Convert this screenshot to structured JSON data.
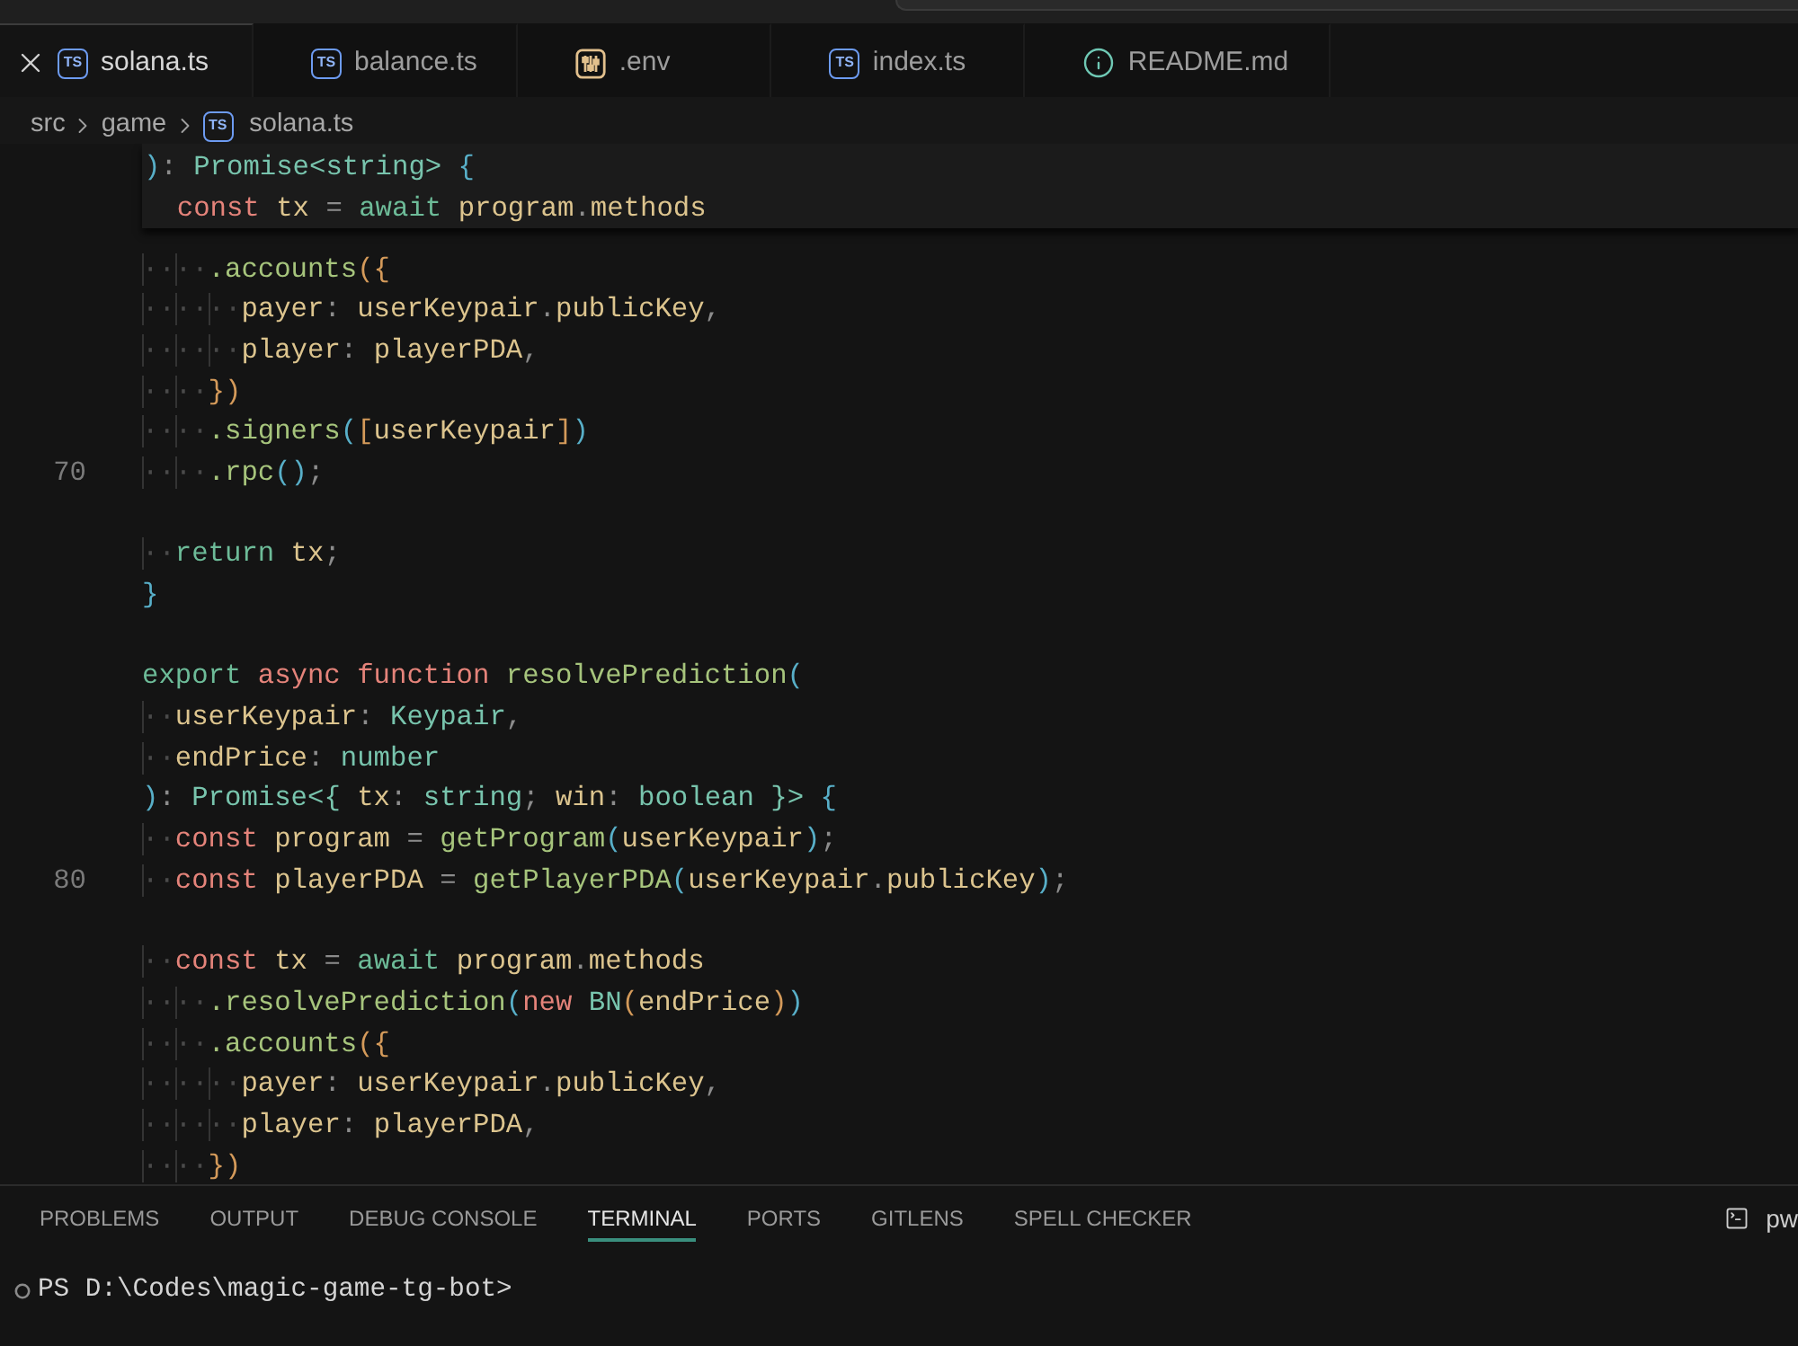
{
  "tabs": [
    {
      "label": "solana.ts",
      "kind": "ts",
      "badge": "TS",
      "selected": true
    },
    {
      "label": "balance.ts",
      "kind": "ts",
      "badge": "TS",
      "selected": false
    },
    {
      "label": ".env",
      "kind": "env",
      "selected": false
    },
    {
      "label": "index.ts",
      "kind": "ts",
      "badge": "TS",
      "selected": false
    },
    {
      "label": "README.md",
      "kind": "info",
      "selected": false
    }
  ],
  "breadcrumb": [
    {
      "label": "src",
      "kind": "folder"
    },
    {
      "label": "game",
      "kind": "folder"
    },
    {
      "label": "solana.ts",
      "kind": "ts",
      "badge": "TS"
    }
  ],
  "editor": {
    "sticky_scroll": [
      {
        "tokens": [
          {
            "text": ")",
            "kind": "bracket1"
          },
          {
            "text": ": ",
            "kind": "punct"
          },
          {
            "text": "Promise<string>",
            "kind": "type"
          },
          {
            "text": " {",
            "kind": "bracket1"
          }
        ],
        "children": [
          {
            "tokens": [
              {
                "text": "const ",
                "kind": "keyword"
              },
              {
                "text": "tx",
                "kind": "variable"
              },
              {
                "text": " = ",
                "kind": "punct"
              },
              {
                "text": "await ",
                "kind": "control"
              },
              {
                "text": "program",
                "kind": "variable"
              },
              {
                "text": ".",
                "kind": "punct"
              },
              {
                "text": "methods",
                "kind": "variable"
              }
            ]
          }
        ]
      }
    ],
    "lines": [
      {
        "kind": "code",
        "tokens": [
          {
            "text": "····",
            "kind": "whitespace"
          },
          {
            "text": ".accounts",
            "kind": "function"
          },
          {
            "text": "({",
            "kind": "bracket2"
          }
        ]
      },
      {
        "kind": "code",
        "tokens": [
          {
            "text": "······",
            "kind": "whitespace"
          },
          {
            "text": "payer",
            "kind": "variable"
          },
          {
            "text": ": ",
            "kind": "punct"
          },
          {
            "text": "userKeypair",
            "kind": "variable"
          },
          {
            "text": ".",
            "kind": "punct"
          },
          {
            "text": "publicKey",
            "kind": "variable"
          },
          {
            "text": ",",
            "kind": "punct"
          }
        ]
      },
      {
        "kind": "code",
        "tokens": [
          {
            "text": "······",
            "kind": "whitespace"
          },
          {
            "text": "player",
            "kind": "variable"
          },
          {
            "text": ": ",
            "kind": "punct"
          },
          {
            "text": "playerPDA",
            "kind": "variable"
          },
          {
            "text": ",",
            "kind": "punct"
          }
        ]
      },
      {
        "kind": "code",
        "tokens": [
          {
            "text": "····",
            "kind": "whitespace"
          },
          {
            "text": "})",
            "kind": "bracket2"
          }
        ]
      },
      {
        "kind": "code",
        "tokens": [
          {
            "text": "····",
            "kind": "whitespace"
          },
          {
            "text": ".signers",
            "kind": "function"
          },
          {
            "text": "(",
            "kind": "bracket1"
          },
          {
            "text": "[",
            "kind": "bracket2"
          },
          {
            "text": "userKeypair",
            "kind": "variable"
          },
          {
            "text": "]",
            "kind": "bracket2"
          },
          {
            "text": ")",
            "kind": "bracket1"
          }
        ]
      },
      {
        "kind": "code",
        "number": "70",
        "tokens": [
          {
            "text": "····",
            "kind": "whitespace"
          },
          {
            "text": ".rpc",
            "kind": "function"
          },
          {
            "text": "()",
            "kind": "bracket1"
          },
          {
            "text": ";",
            "kind": "punct"
          }
        ]
      },
      {
        "kind": "blank"
      },
      {
        "kind": "code",
        "tokens": [
          {
            "text": "··",
            "kind": "whitespace"
          },
          {
            "text": "return ",
            "kind": "control"
          },
          {
            "text": "tx",
            "kind": "variable"
          },
          {
            "text": ";",
            "kind": "punct"
          }
        ]
      },
      {
        "kind": "code",
        "tokens": [
          {
            "text": "}",
            "kind": "bracket1"
          }
        ]
      },
      {
        "kind": "blank"
      },
      {
        "kind": "code",
        "tokens": [
          {
            "text": "export ",
            "kind": "control"
          },
          {
            "text": "async ",
            "kind": "keyword"
          },
          {
            "text": "function ",
            "kind": "keyword"
          },
          {
            "text": "resolvePrediction",
            "kind": "function"
          },
          {
            "text": "(",
            "kind": "bracket1"
          }
        ]
      },
      {
        "kind": "code",
        "tokens": [
          {
            "text": "··",
            "kind": "whitespace"
          },
          {
            "text": "userKeypair",
            "kind": "variable"
          },
          {
            "text": ": ",
            "kind": "punct"
          },
          {
            "text": "Keypair",
            "kind": "type"
          },
          {
            "text": ",",
            "kind": "punct"
          }
        ]
      },
      {
        "kind": "code",
        "tokens": [
          {
            "text": "··",
            "kind": "whitespace"
          },
          {
            "text": "endPrice",
            "kind": "variable"
          },
          {
            "text": ": ",
            "kind": "punct"
          },
          {
            "text": "number",
            "kind": "type"
          }
        ]
      },
      {
        "kind": "code",
        "tokens": [
          {
            "text": ")",
            "kind": "bracket1"
          },
          {
            "text": ": ",
            "kind": "punct"
          },
          {
            "text": "Promise<{ ",
            "kind": "type"
          },
          {
            "text": "tx",
            "kind": "variable"
          },
          {
            "text": ": ",
            "kind": "punct"
          },
          {
            "text": "string",
            "kind": "type"
          },
          {
            "text": "; ",
            "kind": "punct"
          },
          {
            "text": "win",
            "kind": "variable"
          },
          {
            "text": ": ",
            "kind": "punct"
          },
          {
            "text": "boolean",
            "kind": "type"
          },
          {
            "text": " }>",
            "kind": "type"
          },
          {
            "text": " {",
            "kind": "bracket1"
          }
        ]
      },
      {
        "kind": "code",
        "tokens": [
          {
            "text": "··",
            "kind": "whitespace"
          },
          {
            "text": "const ",
            "kind": "keyword"
          },
          {
            "text": "program",
            "kind": "variable"
          },
          {
            "text": " = ",
            "kind": "punct"
          },
          {
            "text": "getProgram",
            "kind": "function"
          },
          {
            "text": "(",
            "kind": "bracket1"
          },
          {
            "text": "userKeypair",
            "kind": "variable"
          },
          {
            "text": ")",
            "kind": "bracket1"
          },
          {
            "text": ";",
            "kind": "punct"
          }
        ]
      },
      {
        "kind": "code",
        "number": "80",
        "tokens": [
          {
            "text": "··",
            "kind": "whitespace"
          },
          {
            "text": "const ",
            "kind": "keyword"
          },
          {
            "text": "playerPDA",
            "kind": "variable"
          },
          {
            "text": " = ",
            "kind": "punct"
          },
          {
            "text": "getPlayerPDA",
            "kind": "function"
          },
          {
            "text": "(",
            "kind": "bracket1"
          },
          {
            "text": "userKeypair",
            "kind": "variable"
          },
          {
            "text": ".",
            "kind": "punct"
          },
          {
            "text": "publicKey",
            "kind": "variable"
          },
          {
            "text": ")",
            "kind": "bracket1"
          },
          {
            "text": ";",
            "kind": "punct"
          }
        ]
      },
      {
        "kind": "blank"
      },
      {
        "kind": "code",
        "tokens": [
          {
            "text": "··",
            "kind": "whitespace"
          },
          {
            "text": "const ",
            "kind": "keyword"
          },
          {
            "text": "tx",
            "kind": "variable"
          },
          {
            "text": " = ",
            "kind": "punct"
          },
          {
            "text": "await ",
            "kind": "control"
          },
          {
            "text": "program",
            "kind": "variable"
          },
          {
            "text": ".",
            "kind": "punct"
          },
          {
            "text": "methods",
            "kind": "variable"
          }
        ]
      },
      {
        "kind": "code",
        "tokens": [
          {
            "text": "····",
            "kind": "whitespace"
          },
          {
            "text": ".resolvePrediction",
            "kind": "function"
          },
          {
            "text": "(",
            "kind": "bracket1"
          },
          {
            "text": "new ",
            "kind": "keyword"
          },
          {
            "text": "BN",
            "kind": "type"
          },
          {
            "text": "(",
            "kind": "bracket2"
          },
          {
            "text": "endPrice",
            "kind": "variable"
          },
          {
            "text": ")",
            "kind": "bracket2"
          },
          {
            "text": ")",
            "kind": "bracket1"
          }
        ]
      },
      {
        "kind": "code",
        "tokens": [
          {
            "text": "····",
            "kind": "whitespace"
          },
          {
            "text": ".accounts",
            "kind": "function"
          },
          {
            "text": "({",
            "kind": "bracket2"
          }
        ]
      },
      {
        "kind": "code",
        "tokens": [
          {
            "text": "······",
            "kind": "whitespace"
          },
          {
            "text": "payer",
            "kind": "variable"
          },
          {
            "text": ": ",
            "kind": "punct"
          },
          {
            "text": "userKeypair",
            "kind": "variable"
          },
          {
            "text": ".",
            "kind": "punct"
          },
          {
            "text": "publicKey",
            "kind": "variable"
          },
          {
            "text": ",",
            "kind": "punct"
          }
        ]
      },
      {
        "kind": "code",
        "tokens": [
          {
            "text": "······",
            "kind": "whitespace"
          },
          {
            "text": "player",
            "kind": "variable"
          },
          {
            "text": ": ",
            "kind": "punct"
          },
          {
            "text": "playerPDA",
            "kind": "variable"
          },
          {
            "text": ",",
            "kind": "punct"
          }
        ]
      },
      {
        "kind": "code",
        "tokens": [
          {
            "text": "····",
            "kind": "whitespace"
          },
          {
            "text": "})",
            "kind": "bracket2"
          }
        ]
      }
    ]
  },
  "panel": {
    "tabs": [
      {
        "label": "PROBLEMS",
        "selected": false
      },
      {
        "label": "OUTPUT",
        "selected": false
      },
      {
        "label": "DEBUG CONSOLE",
        "selected": false
      },
      {
        "label": "TERMINAL",
        "selected": true
      },
      {
        "label": "PORTS",
        "selected": false
      },
      {
        "label": "GITLENS",
        "selected": false
      },
      {
        "label": "SPELL CHECKER",
        "selected": false
      }
    ],
    "terminal_instance": "pw",
    "terminal": {
      "prompt": "PS D:\\Codes\\magic-game-tg-bot>"
    }
  }
}
